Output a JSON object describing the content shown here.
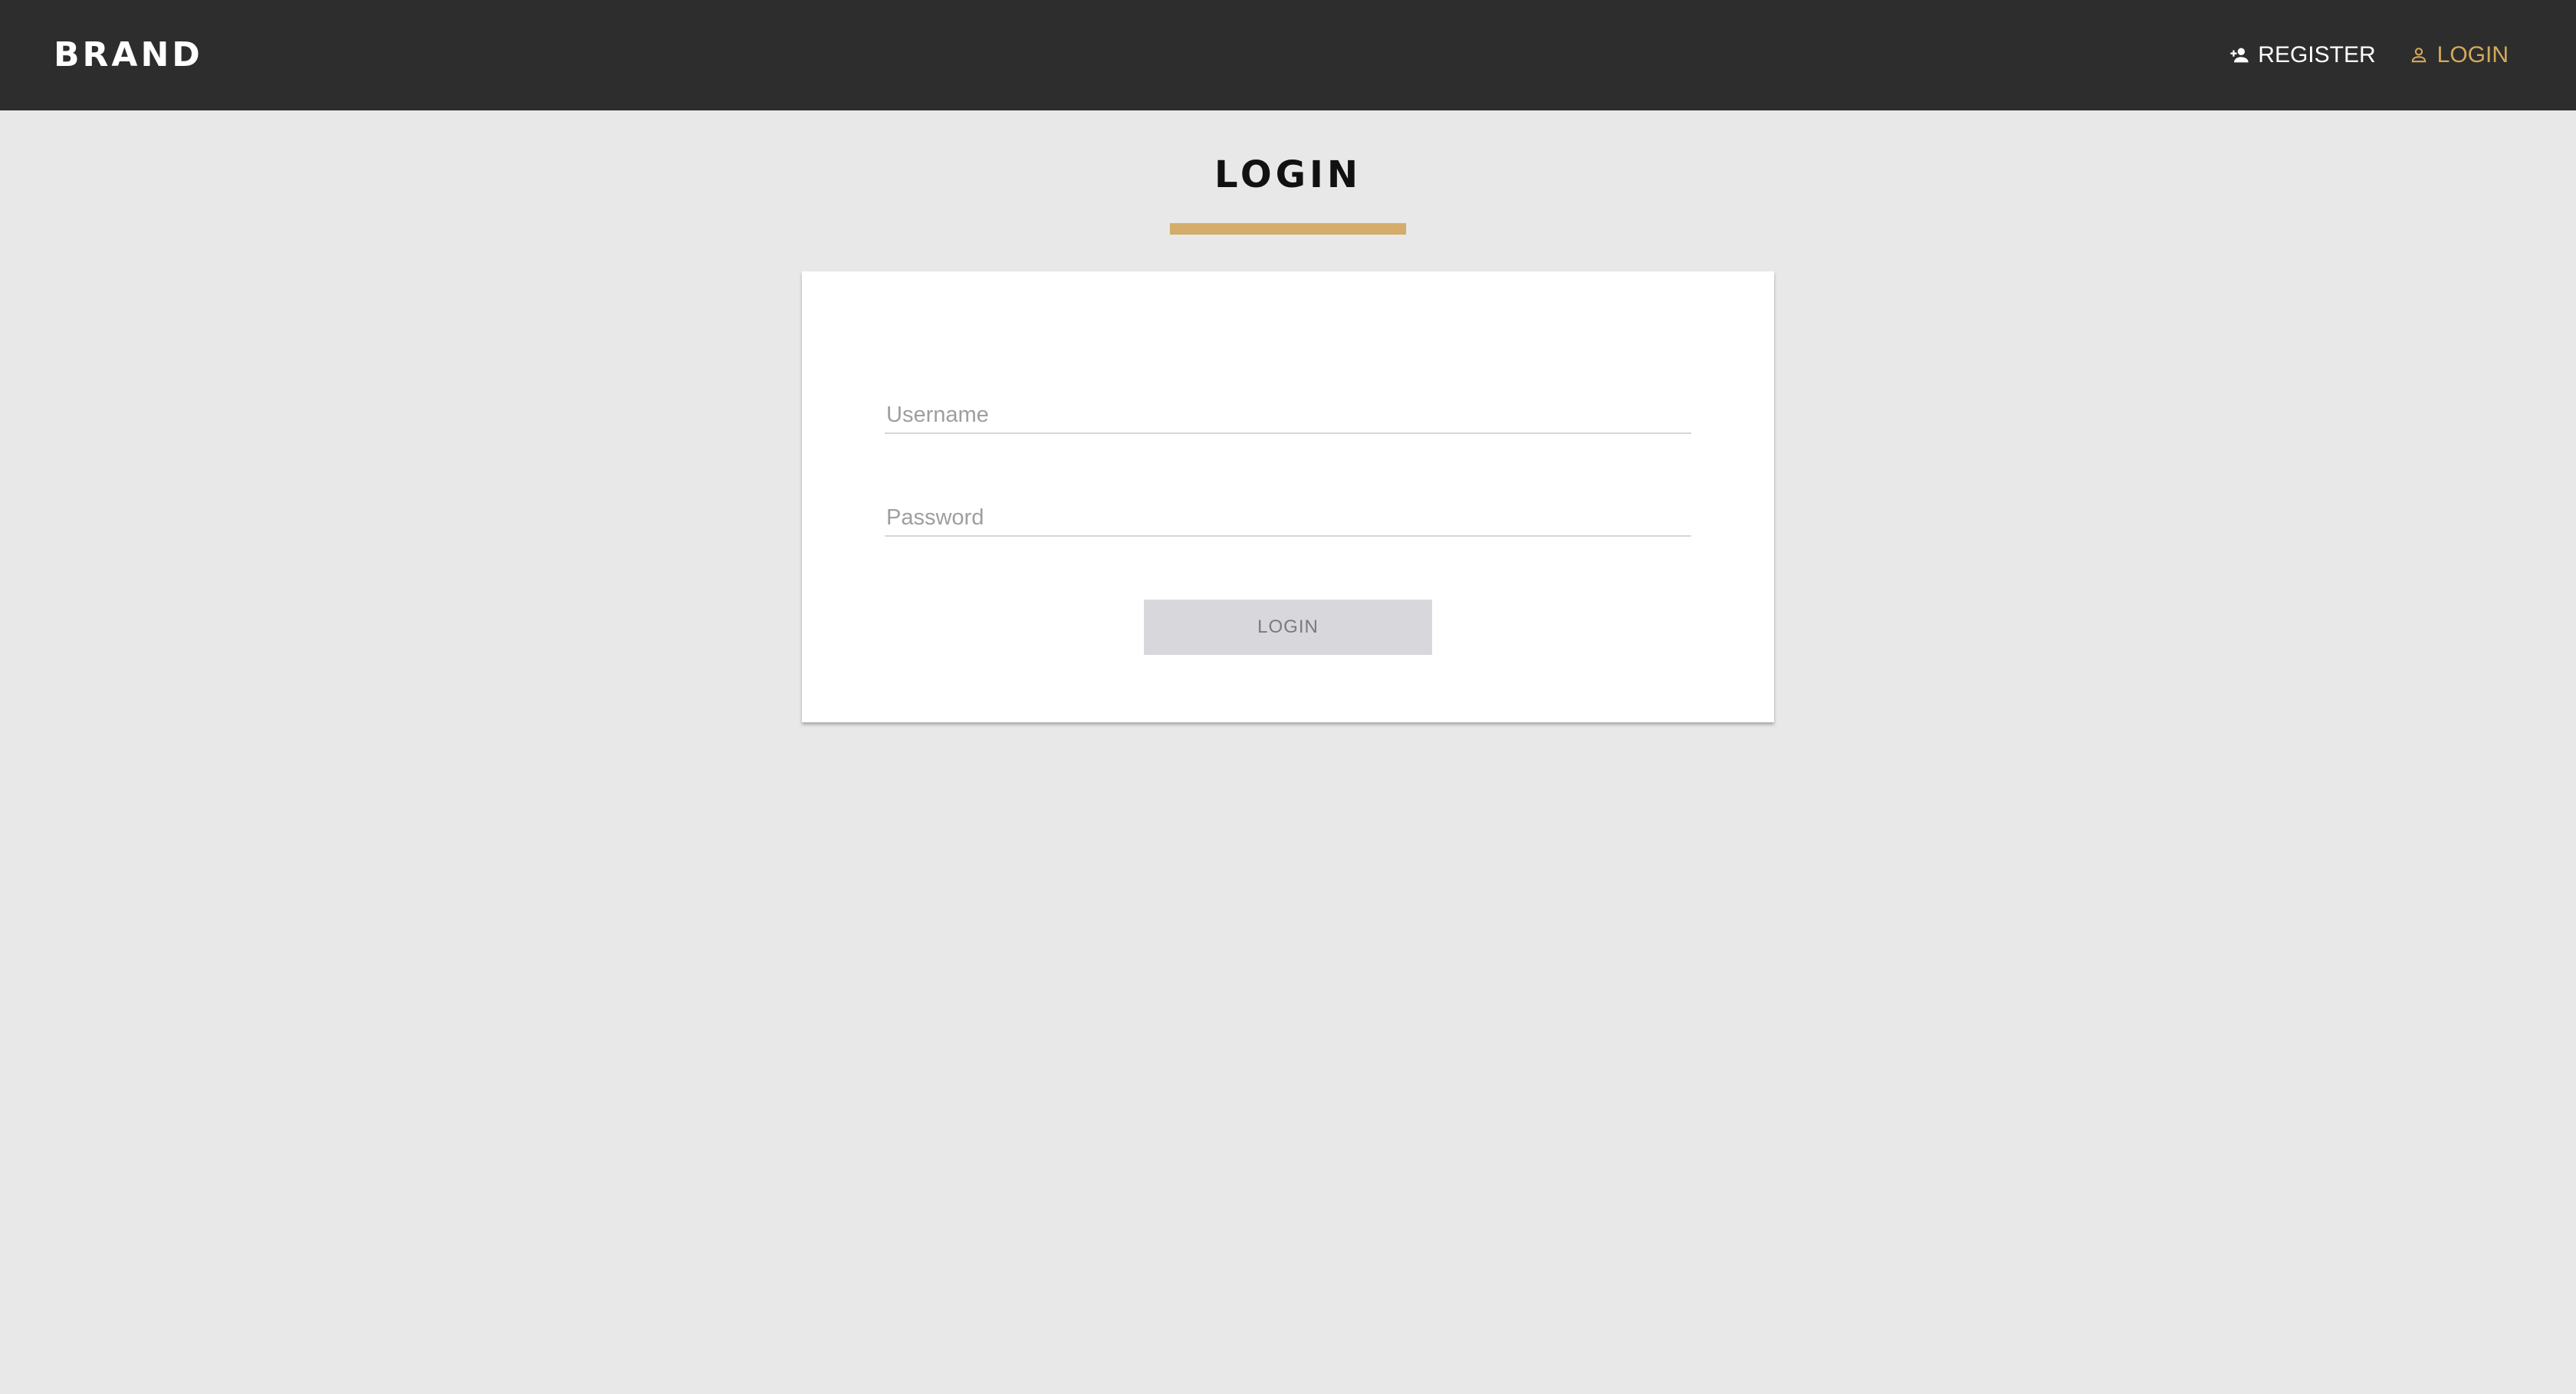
{
  "navbar": {
    "brand": "BRAND",
    "links": [
      {
        "label": "REGISTER",
        "icon": "person-add-icon",
        "color": "#ffffff"
      },
      {
        "label": "LOGIN",
        "icon": "person-icon",
        "color": "#d4a95a",
        "active": true
      }
    ],
    "background": "#2d2d2d"
  },
  "page": {
    "title": "LOGIN",
    "accent_color": "#d4ad6a",
    "background": "#e8e8e8"
  },
  "form": {
    "username": {
      "placeholder": "Username",
      "value": ""
    },
    "password": {
      "placeholder": "Password",
      "value": ""
    },
    "submit_label": "LOGIN",
    "submit_disabled": true
  }
}
